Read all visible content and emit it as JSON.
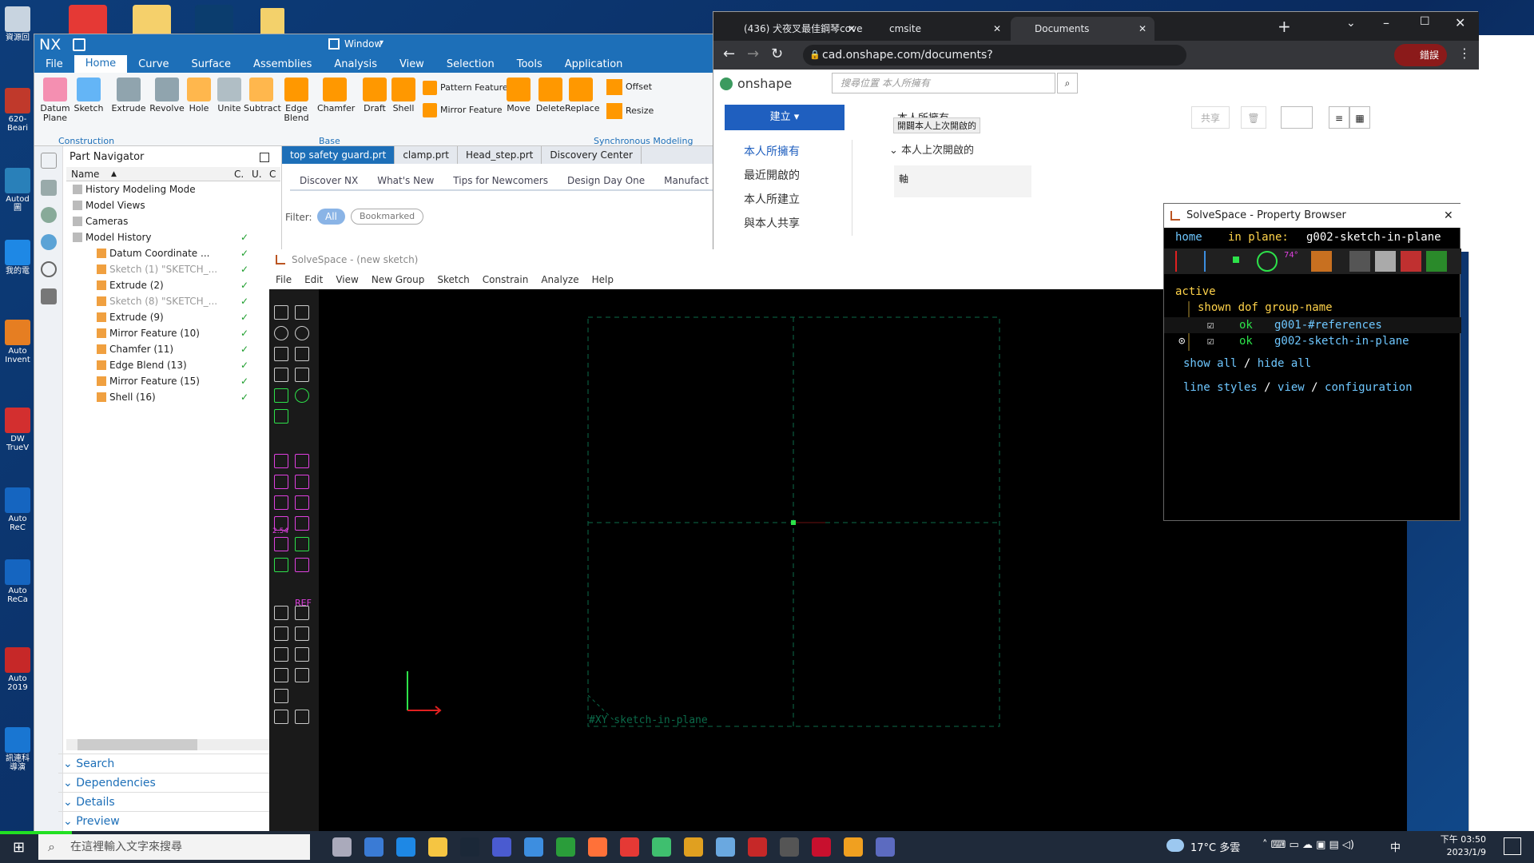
{
  "desktop": {
    "icons": [
      {
        "label": "資源回",
        "color": "#c8d4e0"
      },
      {
        "label": "620-Beari",
        "color": "#c0392b"
      },
      {
        "label": "Autod 圖",
        "color": "#2980b9"
      },
      {
        "label": "我的電",
        "color": "#1e88e5"
      },
      {
        "label": "Auto Invent",
        "color": "#e67e22"
      },
      {
        "label": "DW TrueV",
        "color": "#d32f2f"
      },
      {
        "label": "Auto ReC",
        "color": "#1565c0"
      },
      {
        "label": "Auto ReCa",
        "color": "#1565c0"
      },
      {
        "label": "Auto 2019",
        "color": "#c62828"
      },
      {
        "label": "訊連科 導演",
        "color": "#1976d2"
      }
    ]
  },
  "nx": {
    "logo": "NX",
    "window_menu": "Window",
    "menu": [
      "File",
      "Home",
      "Curve",
      "Surface",
      "Assemblies",
      "Analysis",
      "View",
      "Selection",
      "Tools",
      "Application"
    ],
    "ribbon": {
      "buttons": [
        {
          "label": "Datum Plane",
          "color": "#f48fb1"
        },
        {
          "label": "Sketch",
          "color": "#64b5f6"
        },
        {
          "label": "Extrude",
          "color": "#90a4ae"
        },
        {
          "label": "Revolve",
          "color": "#90a4ae"
        },
        {
          "label": "Hole",
          "color": "#ffb74d"
        },
        {
          "label": "Unite",
          "color": "#b0bec5"
        },
        {
          "label": "Subtract",
          "color": "#ffb74d"
        },
        {
          "label": "Edge Blend",
          "color": "#ff9800"
        },
        {
          "label": "Chamfer",
          "color": "#ff9800"
        },
        {
          "label": "Draft",
          "color": "#ff9800"
        },
        {
          "label": "Shell",
          "color": "#ff9800"
        }
      ],
      "small": [
        "Pattern Feature",
        "Mirror Feature"
      ],
      "sync": [
        {
          "label": "Move",
          "color": "#ff9800"
        },
        {
          "label": "Delete",
          "color": "#ff9800"
        },
        {
          "label": "Replace",
          "color": "#ff9800"
        }
      ],
      "sync_small": [
        "Offset",
        "Resize"
      ],
      "groups": {
        "construction": "Construction",
        "base": "Base",
        "sync": "Synchronous Modeling"
      }
    },
    "navigator": {
      "title": "Part Navigator",
      "cols": {
        "name": "Name",
        "c": "C.",
        "u": "U.",
        "cc": "C"
      },
      "items": [
        {
          "label": "History Modeling Mode",
          "indent": 0,
          "check": "",
          "dim": false
        },
        {
          "label": "Model Views",
          "indent": 0,
          "check": "",
          "dim": false
        },
        {
          "label": "Cameras",
          "indent": 0,
          "check": "",
          "dim": false
        },
        {
          "label": "Model History",
          "indent": 0,
          "check": "✓",
          "dim": false
        },
        {
          "label": "Datum Coordinate ...",
          "indent": 1,
          "check": "✓",
          "dim": false
        },
        {
          "label": "Sketch (1) \"SKETCH_...",
          "indent": 1,
          "check": "✓",
          "dim": true
        },
        {
          "label": "Extrude (2)",
          "indent": 1,
          "check": "✓",
          "dim": false
        },
        {
          "label": "Sketch (8) \"SKETCH_...",
          "indent": 1,
          "check": "✓",
          "dim": true
        },
        {
          "label": "Extrude (9)",
          "indent": 1,
          "check": "✓",
          "dim": false
        },
        {
          "label": "Mirror Feature (10)",
          "indent": 1,
          "check": "✓",
          "dim": false
        },
        {
          "label": "Chamfer (11)",
          "indent": 1,
          "check": "✓",
          "dim": false
        },
        {
          "label": "Edge Blend (13)",
          "indent": 1,
          "check": "✓",
          "dim": false
        },
        {
          "label": "Mirror Feature (15)",
          "indent": 1,
          "check": "✓",
          "dim": false
        },
        {
          "label": "Shell (16)",
          "indent": 1,
          "check": "✓",
          "dim": false
        }
      ],
      "panels": [
        "Search",
        "Dependencies",
        "Details",
        "Preview"
      ]
    },
    "doc_tabs": [
      "top safety guard.prt",
      "clamp.prt",
      "Head_step.prt",
      "Discovery Center"
    ],
    "discovery": {
      "tabs": [
        "Discover NX",
        "What's New",
        "Tips for Newcomers",
        "Design Day One",
        "Manufact"
      ],
      "filter": "Filter:",
      "all": "All",
      "bookmarked": "Bookmarked"
    }
  },
  "chrome": {
    "tabs": [
      {
        "title": "(436) 犬夜叉最佳鋼琴cove",
        "active": false
      },
      {
        "title": "cmsite",
        "active": false
      },
      {
        "title": "Documents",
        "active": true
      }
    ],
    "url": "cad.onshape.com/documents?resourceType=resourceuserowner...",
    "profile": "錯誤",
    "onshape": {
      "brand": "onshape",
      "search_placeholder": "搜尋位置 本人所擁有",
      "create": "建立 ▾",
      "owner_label": "本人所擁有",
      "tooltip": "開闢本人上次開啟的",
      "share": "共享",
      "sidebar": [
        "本人所擁有",
        "最近開啟的",
        "本人所建立",
        "與本人共享"
      ],
      "section": "本人上次開啟的",
      "card_label": "軸"
    }
  },
  "solvespace": {
    "title": "SolveSpace - (new sketch)",
    "menu": [
      "File",
      "Edit",
      "View",
      "New Group",
      "Sketch",
      "Constrain",
      "Analyze",
      "Help"
    ],
    "dim_labels": {
      "dim": "2.54",
      "angle": "74°",
      "ref": "REF"
    },
    "workplane_label": "#XY  sketch-in-plane"
  },
  "property_browser": {
    "title": "SolveSpace - Property Browser",
    "home": "home",
    "in_plane": "in plane:",
    "plane_name": "g002-sketch-in-plane",
    "active": "active",
    "header": "shown dof group-name",
    "groups": [
      {
        "status": "ok",
        "name": "g001-#references",
        "active": false
      },
      {
        "status": "ok",
        "name": "g002-sketch-in-plane",
        "active": true
      }
    ],
    "show_all": "show all",
    "hide_all": "hide all",
    "line_styles": "line styles",
    "view": "view",
    "configuration": "configuration"
  },
  "taskbar": {
    "search_placeholder": "在這裡輸入文字來搜尋",
    "weather": "17°C 多雲",
    "ime": "中",
    "time": "下午 03:50",
    "date": "2023/1/9"
  }
}
